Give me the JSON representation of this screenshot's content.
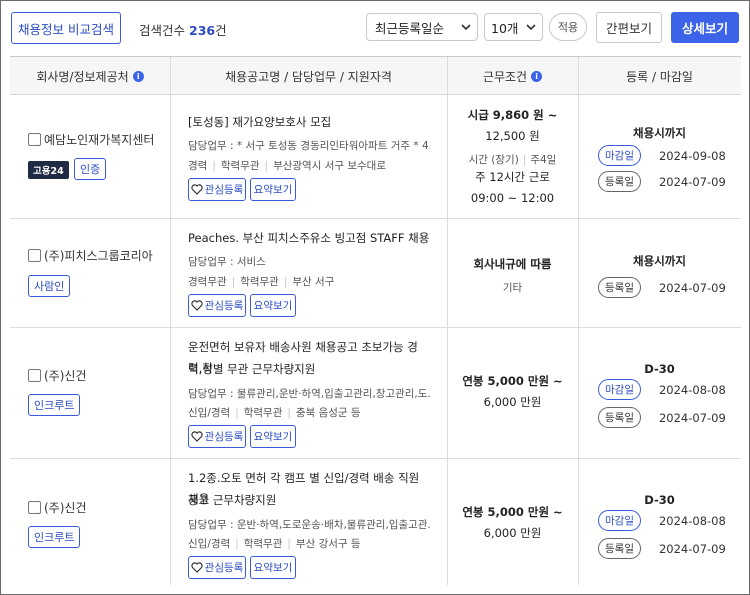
{
  "toolbar": {
    "compare_label": "채용정보 비교검색",
    "count_prefix": "검색건수",
    "count_value": "236",
    "count_suffix": "건",
    "sort_selected": "최근등록일순",
    "per_page_selected": "10개",
    "apply_label": "적용",
    "simple_view_label": "간편보기",
    "detail_view_label": "상세보기"
  },
  "table": {
    "headers": {
      "company": "회사명/정보제공처",
      "posting": "채용공고명 / 담당업무 / 지원자격",
      "conditions": "근무조건",
      "dates": "등록 / 마감일"
    },
    "actions": {
      "interest_label": "관심등록",
      "summary_label": "요약보기"
    },
    "rows": [
      {
        "company": "예담노인재가복지센터",
        "badge": "고용24",
        "source": "인증",
        "title": "[토성동] 재가요양보호사 모집",
        "duty": "담당업무 : * 서구 토성동 경동리인타워아파트 거주 * 4...",
        "quals": [
          "경력",
          "학력무관",
          "부산광역시 서구 보수대로"
        ],
        "pay_line1": "시급 9,860 원 ~",
        "pay_line2": "12,500 원",
        "type_line": "시간 (장기)",
        "days": "주4일",
        "hours": "주 12시간 근로",
        "time": "09:00 ~ 12:00",
        "deadline_text": "채용시까지",
        "deadline_label": "마감일",
        "deadline_date": "2024-09-08",
        "reg_label": "등록일",
        "reg_date": "2024-07-09"
      },
      {
        "company": "(주)피치스그룹코리아",
        "source": "사람인",
        "title": "Peaches. 부산 피치스주유소 빙고점 STAFF 채용",
        "duty": "담당업무 : 서비스",
        "quals": [
          "경력무관",
          "학력무관",
          "부산 서구"
        ],
        "cond_main": "회사내규에 따름",
        "cond_sub": "기타",
        "deadline_text": "채용시까지",
        "reg_label": "등록일",
        "reg_date": "2024-07-09"
      },
      {
        "company": "(주)신건",
        "source": "인크루트",
        "title_line1": "운전면허 보유자 배송사원 채용공고 초보가능 경력,학",
        "title_line2": "력,성별 무관 근무차량지원",
        "duty": "담당업무 : 물류관리,운반·하역,입출고관리,창고관리,도...",
        "quals": [
          "신입/경력",
          "학력무관",
          "충북 음성군 등"
        ],
        "pay_line1": "연봉 5,000 만원 ~",
        "pay_line2": "6,000 만원",
        "deadline_text": "D-30",
        "deadline_label": "마감일",
        "deadline_date": "2024-08-08",
        "reg_label": "등록일",
        "reg_date": "2024-07-09"
      },
      {
        "company": "(주)신건",
        "source": "인크루트",
        "title_line1": "1.2종.오토 면허 각 캠프 별 신입/경력 배송 직원 채용",
        "title_line2": "공고 근무차량지원",
        "duty": "담당업무 : 운반·하역,도로운송·배차,물류관리,입출고관...",
        "quals": [
          "신입/경력",
          "학력무관",
          "부산 강서구 등"
        ],
        "pay_line1": "연봉 5,000 만원 ~",
        "pay_line2": "6,000 만원",
        "deadline_text": "D-30",
        "deadline_label": "마감일",
        "deadline_date": "2024-08-08",
        "reg_label": "등록일",
        "reg_date": "2024-07-09"
      }
    ]
  },
  "colors": {
    "accent": "#3d63e8",
    "badge_dark": "#1f2a44",
    "header_bg": "#f6f6f6"
  },
  "icons": [
    "chevron-down-icon",
    "info-icon",
    "heart-icon",
    "checkbox-icon"
  ]
}
